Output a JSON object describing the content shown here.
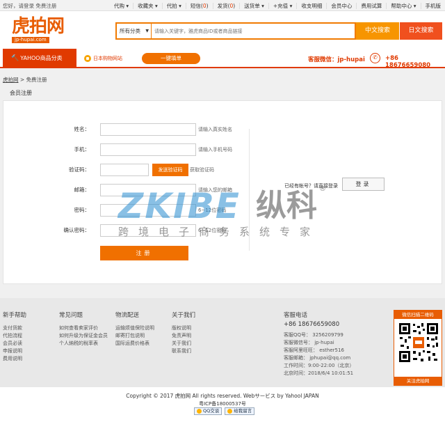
{
  "top": {
    "greeting": "您好，请登录",
    "register": "免费注册",
    "nav": [
      {
        "label": "代购",
        "suffix": " ▾"
      },
      {
        "label": "收藏夹",
        "suffix": " ▾"
      },
      {
        "label": "代拍",
        "suffix": " ▾"
      },
      {
        "label": "短信",
        "count": "0"
      },
      {
        "label": "发货",
        "count": "0"
      },
      {
        "label": "送货单",
        "suffix": " ▾"
      },
      {
        "label": "+充值",
        "suffix": " ▾"
      },
      {
        "label": "收支明细"
      },
      {
        "label": "会员中心"
      },
      {
        "label": "费用试算"
      },
      {
        "label": "帮助中心",
        "suffix": " ▾"
      },
      {
        "label": "手机版"
      }
    ]
  },
  "logo": {
    "text": "虎拍网",
    "url": "jp-hupai.com"
  },
  "search": {
    "category": "所有分类",
    "placeholder": "请输入关键字，雅虎商品ID或者商品链接",
    "btn_cn": "中文搜索",
    "btn_jp": "日文搜索"
  },
  "nav": {
    "category_tab": "YAHOO商品分类",
    "jp_link": "日本购物网站",
    "one_click": "一键填单",
    "wechat": "客服微信：jp-hupai",
    "phone": "+86 18676659080"
  },
  "breadcrumb": {
    "home": "虎拍网",
    "sep": " > ",
    "current": "免费注册"
  },
  "page_title": "会员注册",
  "form": {
    "name": {
      "label": "姓名：",
      "hint": "请输入真实姓名"
    },
    "mobile": {
      "label": "手机：",
      "hint": "请输入手机号码"
    },
    "code": {
      "label": "验证码：",
      "button": "发送验证码",
      "hint": "获取验证码"
    },
    "email": {
      "label": "邮箱：",
      "hint": "请输入您的邮箱"
    },
    "password": {
      "label": "密码：",
      "hint": "6~12位密码"
    },
    "confirm": {
      "label": "确认密码：",
      "hint": "6~12位密码"
    },
    "submit": "注册"
  },
  "login": {
    "text": "已经有帐号？请直接登录",
    "button": "登录"
  },
  "watermark": {
    "brand": "ZKIBE",
    "cn": "纵科",
    "reg": "®",
    "sub": "跨境电子商务系统专家"
  },
  "footer": {
    "cols": [
      {
        "title": "新手帮助",
        "items": [
          "支付货款",
          "代拍流程",
          "会员必读",
          "申报说明",
          "费用说明"
        ]
      },
      {
        "title": "常见问题",
        "items": [
          "如何查看卖家评价",
          "如何升级为保证金会员",
          "个人納税的稅率表"
        ]
      },
      {
        "title": "物流配送",
        "items": [
          "运输烦值保险说明",
          "邮寄打包说明",
          "国际运费价格表"
        ]
      },
      {
        "title": "关于我们",
        "items": [
          "版权说明",
          "免责声明",
          "关于我们",
          "联系我们"
        ]
      }
    ],
    "service": {
      "title": "客服电话",
      "tel": "+86 18676659080",
      "lines": [
        "客服QQ号： 3256209799",
        "客服微信号： jp-hupai",
        "客服阿里旺旺： esther516",
        "客服邮箱： jphupai@qq.com",
        "工作时间：9:00-22:00（北京）",
        "北京时间：2018/6/4 10:01:51"
      ]
    },
    "qr": {
      "top": "微信扫描二维码",
      "bottom": "关注虎拍网"
    }
  },
  "copyright": "Copyright © 2017 虎拍网 All rights reserved.   Webサービス by Yahool JAPAN",
  "icp": "粤ICP备18000537号",
  "badges": {
    "qq": "QQ交谈",
    "msg": "给我留言"
  }
}
